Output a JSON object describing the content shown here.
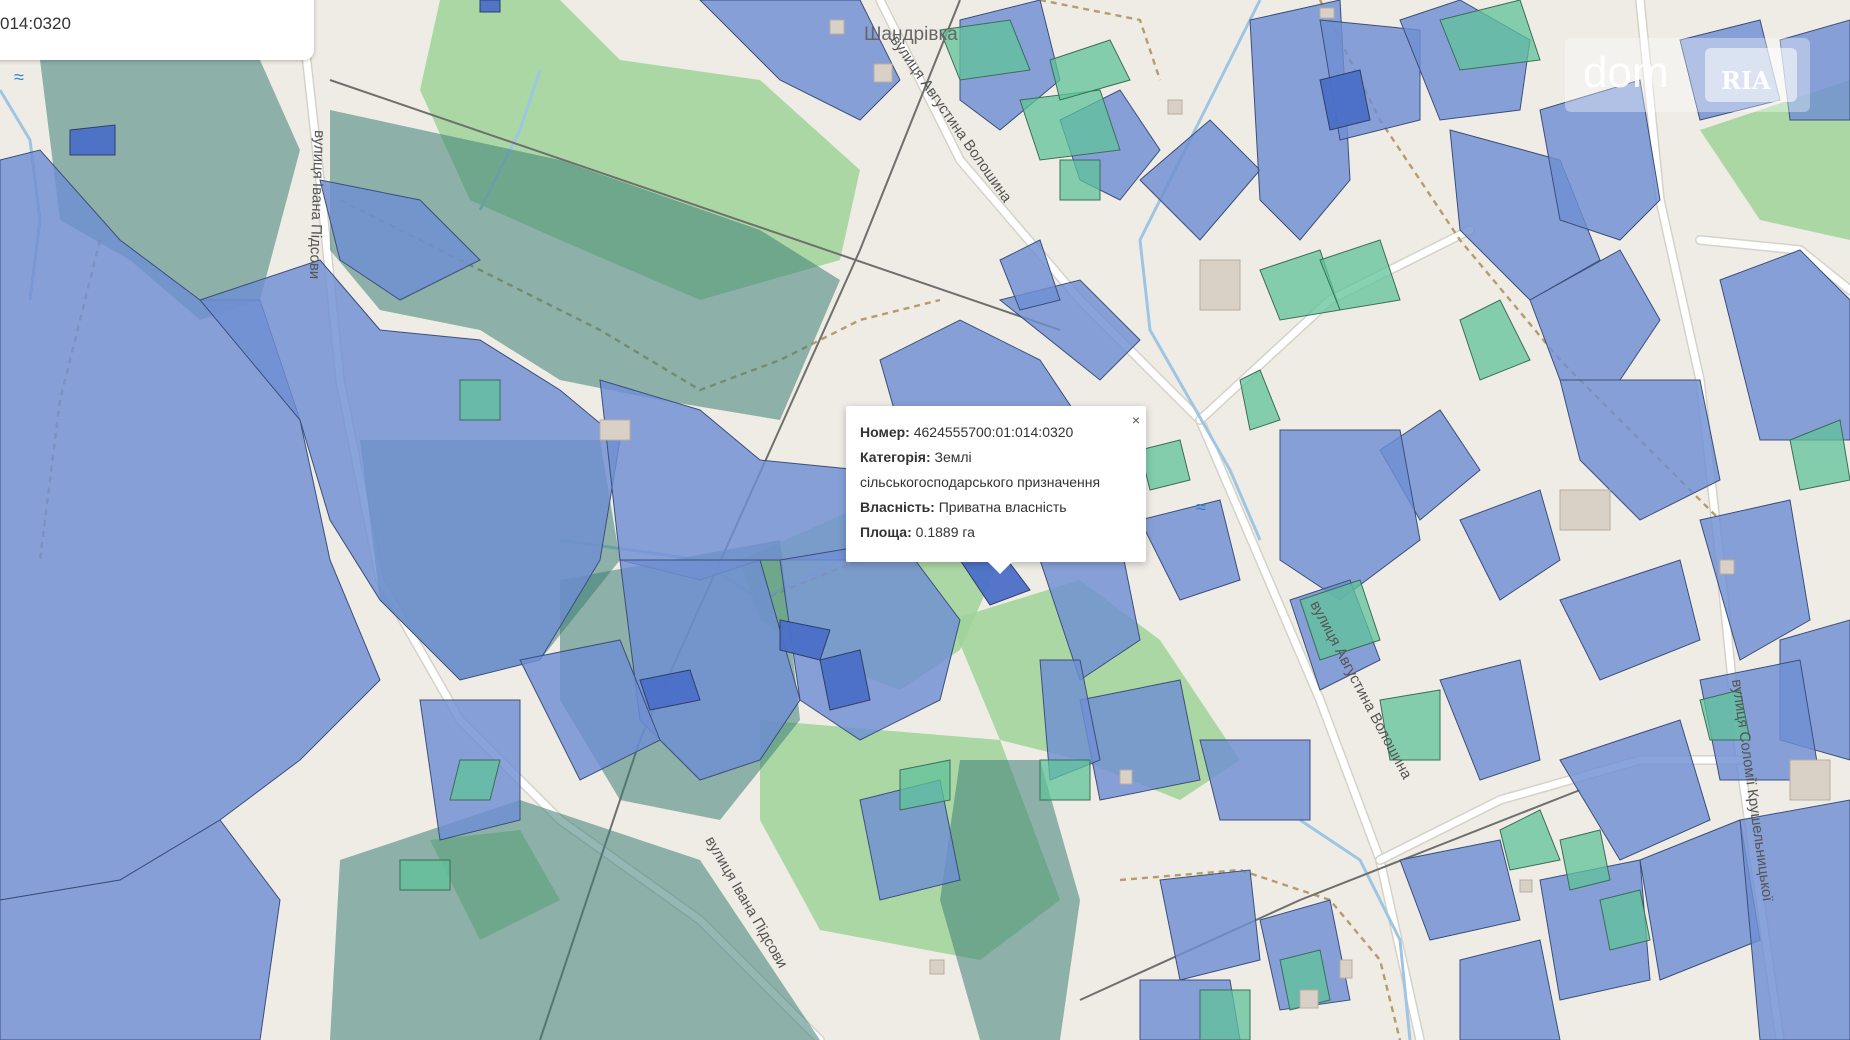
{
  "search": {
    "value": "014:0320"
  },
  "popup": {
    "number_label": "Номер:",
    "number_value": "4624555700:01:014:0320",
    "category_label": "Категорія:",
    "category_value_1": "Землі",
    "category_value_2": "сільськогосподарського призначення",
    "ownership_label": "Власність:",
    "ownership_value": "Приватна власність",
    "area_label": "Площа:",
    "area_value": "0.1889 га",
    "close_symbol": "×"
  },
  "map_labels": {
    "place": "Шандрівка",
    "street_voloshyna_1": "вулиця Августина Волошина",
    "street_voloshyna_2": "вулиця Августина Волошина",
    "street_pidsovy_1": "вулиця Івана Підсови",
    "street_pidsovy_2": "вулиця Івана Підсови",
    "street_krushelnytskoi": "вулиця Соломії Крушельницької"
  },
  "watermark": {
    "dom": "dom",
    "ria": "RIA"
  },
  "icons": {
    "water_icon": "waterfall-icon"
  },
  "colors": {
    "parcel": "#6f8fd3",
    "parcel_green": "#5fc39a",
    "forest": "#9fd49a"
  }
}
